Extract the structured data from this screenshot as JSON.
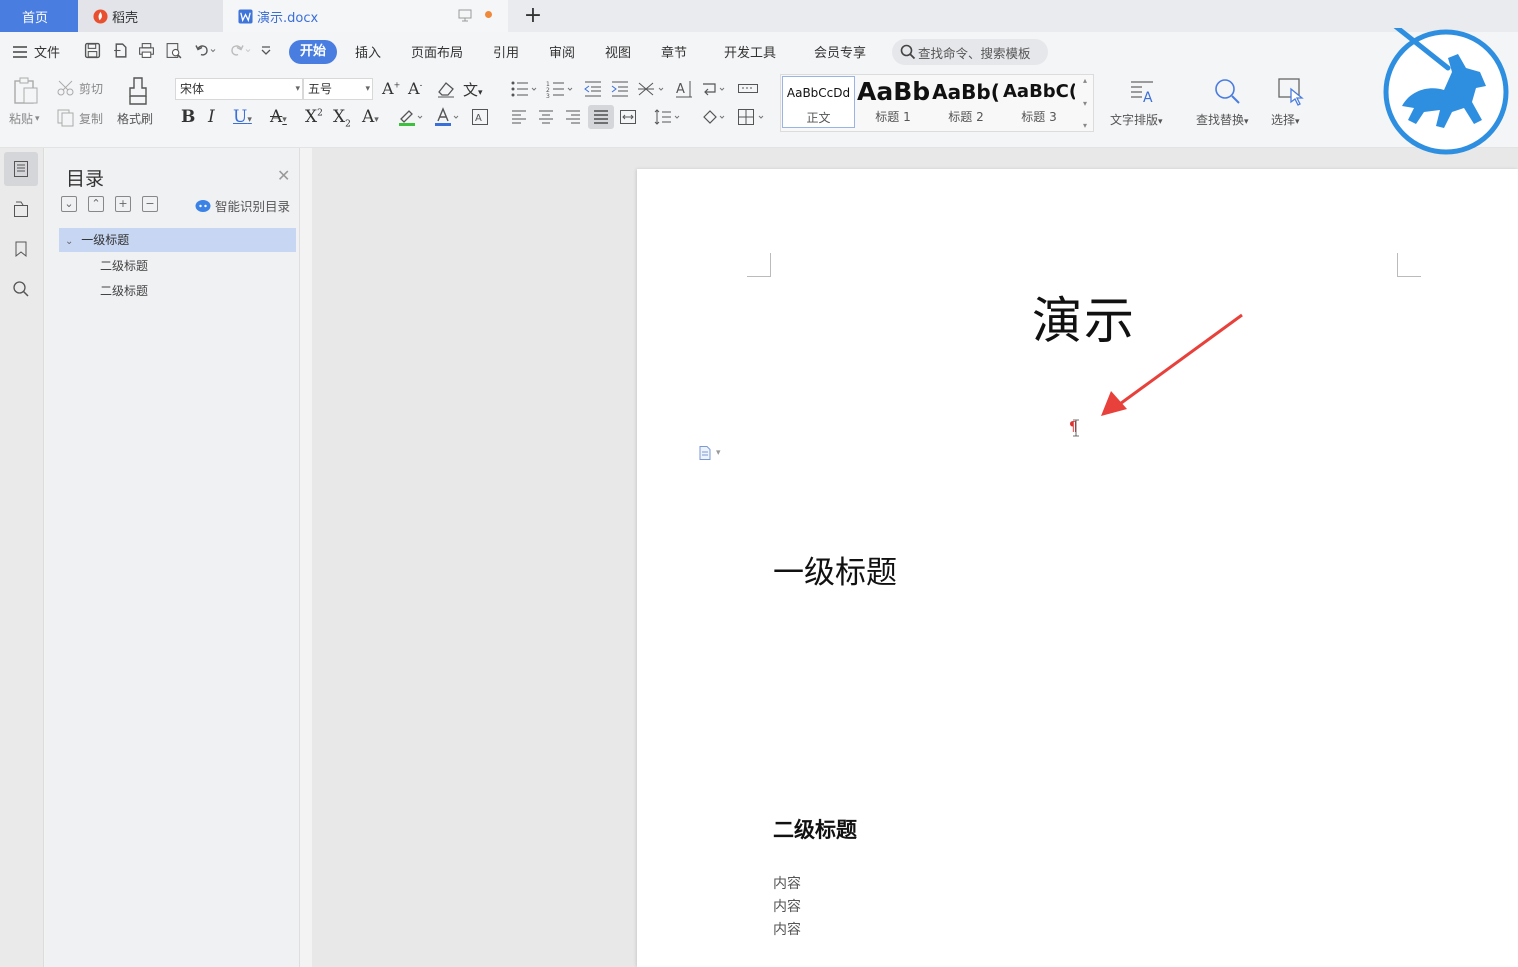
{
  "tabs": {
    "home": "首页",
    "docer": "稻壳",
    "doc": "演示.docx"
  },
  "menu": {
    "file": "文件",
    "start": "开始",
    "insert": "插入",
    "page_layout": "页面布局",
    "references": "引用",
    "review": "审阅",
    "view": "视图",
    "chapter": "章节",
    "dev_tools": "开发工具",
    "member": "会员专享",
    "search_placeholder": "查找命令、搜索模板"
  },
  "ribbon": {
    "paste": "粘贴",
    "cut": "剪切",
    "copy": "复制",
    "format_painter": "格式刷",
    "font_name": "宋体",
    "font_size": "五号",
    "styles": [
      {
        "sample": "AaBbCcDd",
        "name": "正文"
      },
      {
        "sample": "AaBb",
        "name": "标题 1"
      },
      {
        "sample": "AaBb(",
        "name": "标题 2"
      },
      {
        "sample": "AaBbC(",
        "name": "标题 3"
      }
    ],
    "text_layout": "文字排版",
    "find_replace": "查找替换",
    "select": "选择"
  },
  "toc": {
    "title": "目录",
    "smart": "智能识别目录",
    "items": [
      {
        "label": "一级标题",
        "level": 1
      },
      {
        "label": "二级标题",
        "level": 2
      },
      {
        "label": "二级标题",
        "level": 2
      }
    ]
  },
  "document": {
    "title": "演示",
    "h1": "一级标题",
    "h2": "二级标题",
    "body": [
      "内容",
      "内容",
      "内容"
    ]
  },
  "colors": {
    "accent": "#4a7de0",
    "arrow": "#e8403a",
    "logo": "#2e8fe0"
  }
}
